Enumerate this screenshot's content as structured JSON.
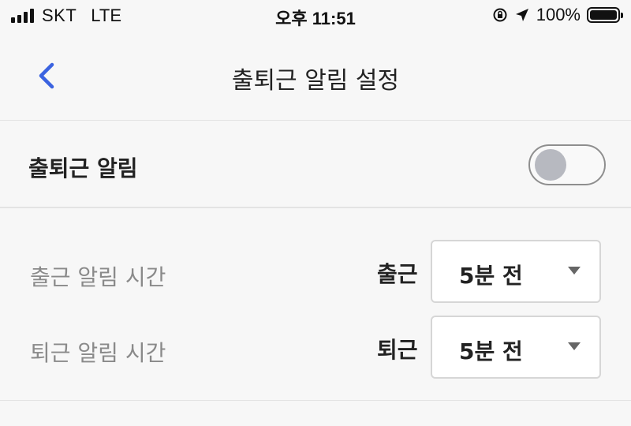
{
  "status_bar": {
    "carrier": "SKT",
    "network": "LTE",
    "time": "오후 11:51",
    "battery": "100%",
    "icons": [
      "signal-icon",
      "rotation-lock-icon",
      "location-arrow-icon",
      "battery-icon"
    ]
  },
  "nav": {
    "back_icon": "chevron-left-icon",
    "title": "출퇴근 알림 설정",
    "accent_color": "#3b63e0"
  },
  "commute_alert": {
    "label": "출퇴근 알림",
    "enabled": false
  },
  "times": [
    {
      "label": "출근 알림 시간",
      "prefix": "출근",
      "selected": "5분 전"
    },
    {
      "label": "퇴근 알림 시간",
      "prefix": "퇴근",
      "selected": "5분 전"
    }
  ]
}
